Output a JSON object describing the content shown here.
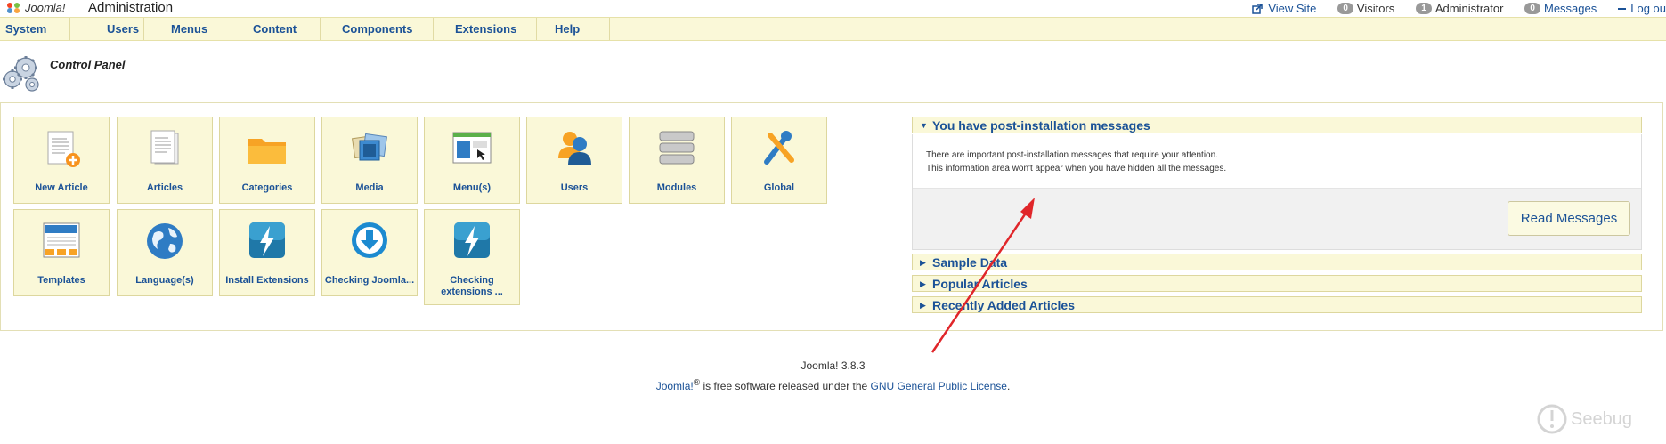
{
  "header": {
    "logo_text": "Joomla!",
    "title": "Administration",
    "status": {
      "view_site": "View Site",
      "visitors_count": "0",
      "visitors_label": "Visitors",
      "admin_count": "1",
      "admin_label": "Administrator",
      "messages_count": "0",
      "messages_label": "Messages",
      "logout": "Log ou"
    }
  },
  "menu": [
    "System",
    "Users",
    "Menus",
    "Content",
    "Components",
    "Extensions",
    "Help"
  ],
  "page": {
    "title": "Control Panel"
  },
  "quickicons": [
    {
      "label": "New Article",
      "icon": "new-article-icon"
    },
    {
      "label": "Articles",
      "icon": "articles-icon"
    },
    {
      "label": "Categories",
      "icon": "folder-icon"
    },
    {
      "label": "Media",
      "icon": "media-icon"
    },
    {
      "label": "Menu(s)",
      "icon": "menu-icon"
    },
    {
      "label": "Users",
      "icon": "users-icon"
    },
    {
      "label": "Modules",
      "icon": "modules-icon"
    },
    {
      "label": "Global",
      "icon": "tools-icon"
    },
    {
      "label": "Templates",
      "icon": "templates-icon"
    },
    {
      "label": "Language(s)",
      "icon": "globe-icon"
    },
    {
      "label": "Install Extensions",
      "icon": "lightning-icon"
    },
    {
      "label": "Checking Joomla...",
      "icon": "download-icon"
    },
    {
      "label": "Checking extensions ...",
      "icon": "lightning-icon"
    }
  ],
  "postinstall": {
    "heading": "You have post-installation messages",
    "line1": "There are important post-installation messages that require your attention.",
    "line2": "This information area won't appear when you have hidden all the messages.",
    "button": "Read Messages"
  },
  "panels": [
    "Sample Data",
    "Popular Articles",
    "Recently Added Articles"
  ],
  "footer": {
    "version": "Joomla! 3.8.3",
    "brand": "Joomla!",
    "reg": "®",
    "middle": " is free software released under the ",
    "license": "GNU General Public License",
    "end": "."
  },
  "watermark": "Seebug",
  "colors": {
    "link": "#1b5297",
    "menu_bg": "#faf8d8",
    "annotation_arrow": "#e0262a"
  }
}
